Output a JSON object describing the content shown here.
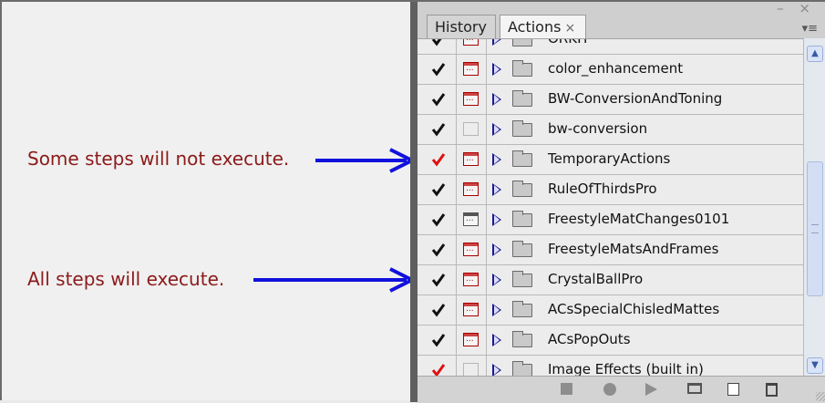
{
  "annotations": {
    "some_steps": "Some steps will not execute.",
    "all_steps": "All steps will execute."
  },
  "panel": {
    "tabs": [
      {
        "label": "History",
        "active": false
      },
      {
        "label": "Actions",
        "active": true,
        "close_glyph": "×"
      }
    ],
    "window_controls": "– ×",
    "menu_glyph": "▾≡",
    "list": [
      {
        "label": "ORKH",
        "checked": true,
        "check_color": "black",
        "dialog": "red"
      },
      {
        "label": "color_enhancement",
        "checked": true,
        "check_color": "black",
        "dialog": "red"
      },
      {
        "label": "BW-ConversionAndToning",
        "checked": true,
        "check_color": "black",
        "dialog": "red"
      },
      {
        "label": "bw-conversion",
        "checked": true,
        "check_color": "black",
        "dialog": "none"
      },
      {
        "label": "TemporaryActions",
        "checked": true,
        "check_color": "red",
        "dialog": "red"
      },
      {
        "label": "RuleOfThirdsPro",
        "checked": true,
        "check_color": "black",
        "dialog": "red"
      },
      {
        "label": "FreestyleMatChanges0101",
        "checked": true,
        "check_color": "black",
        "dialog": "gray"
      },
      {
        "label": "FreestyleMatsAndFrames",
        "checked": true,
        "check_color": "black",
        "dialog": "red"
      },
      {
        "label": "CrystalBallPro",
        "checked": true,
        "check_color": "black",
        "dialog": "red"
      },
      {
        "label": "ACsSpecialChisledMattes",
        "checked": true,
        "check_color": "black",
        "dialog": "red"
      },
      {
        "label": "ACsPopOuts",
        "checked": true,
        "check_color": "black",
        "dialog": "red"
      },
      {
        "label": "Image Effects (built in)",
        "checked": true,
        "check_color": "red",
        "dialog": "none"
      }
    ],
    "toolbar": [
      "stop-icon",
      "record-icon",
      "play-icon",
      "new-set-icon",
      "new-action-icon",
      "delete-icon"
    ],
    "colors": {
      "arrow": "#1111dd",
      "annotation_text": "#8b1a1a",
      "check_red": "#d11",
      "check_black": "#111"
    }
  }
}
